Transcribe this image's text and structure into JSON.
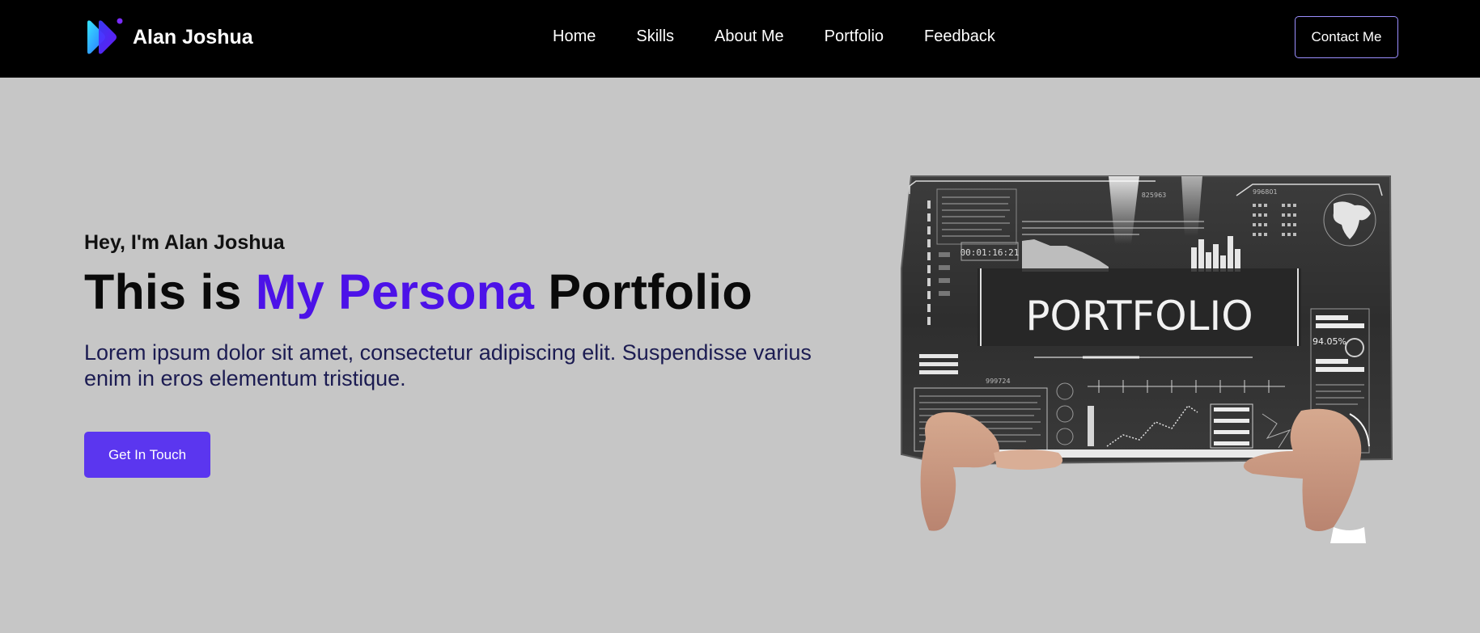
{
  "brand": {
    "name": "Alan Joshua",
    "logo_icon": "play-arrow-logo-icon",
    "colors": {
      "primary": "#4c12e8",
      "cyan": "#33e0ff",
      "blue": "#2f5bff"
    }
  },
  "nav": {
    "links": [
      {
        "label": "Home"
      },
      {
        "label": "Skills"
      },
      {
        "label": "About Me"
      },
      {
        "label": "Portfolio"
      },
      {
        "label": "Feedback"
      }
    ],
    "contact_label": "Contact Me"
  },
  "hero": {
    "greeting": "Hey, I'm Alan Joshua",
    "title_prefix": "This is ",
    "title_accent": "My Persona",
    "title_suffix": " Portfolio",
    "description": "Lorem ipsum dolor sit amet, consectetur adipiscing elit. Suspendisse varius enim in eros elementum tristique.",
    "cta_label": "Get In Touch",
    "accent_color": "#4c12e8",
    "cta_color": "#5b36ef"
  },
  "hero_image": {
    "screen_title": "PORTFOLIO",
    "timer": "00:01:16:21",
    "percentage": "94.05%",
    "code_top": "825963",
    "code_right": "996801",
    "code_bottom": "999724"
  }
}
